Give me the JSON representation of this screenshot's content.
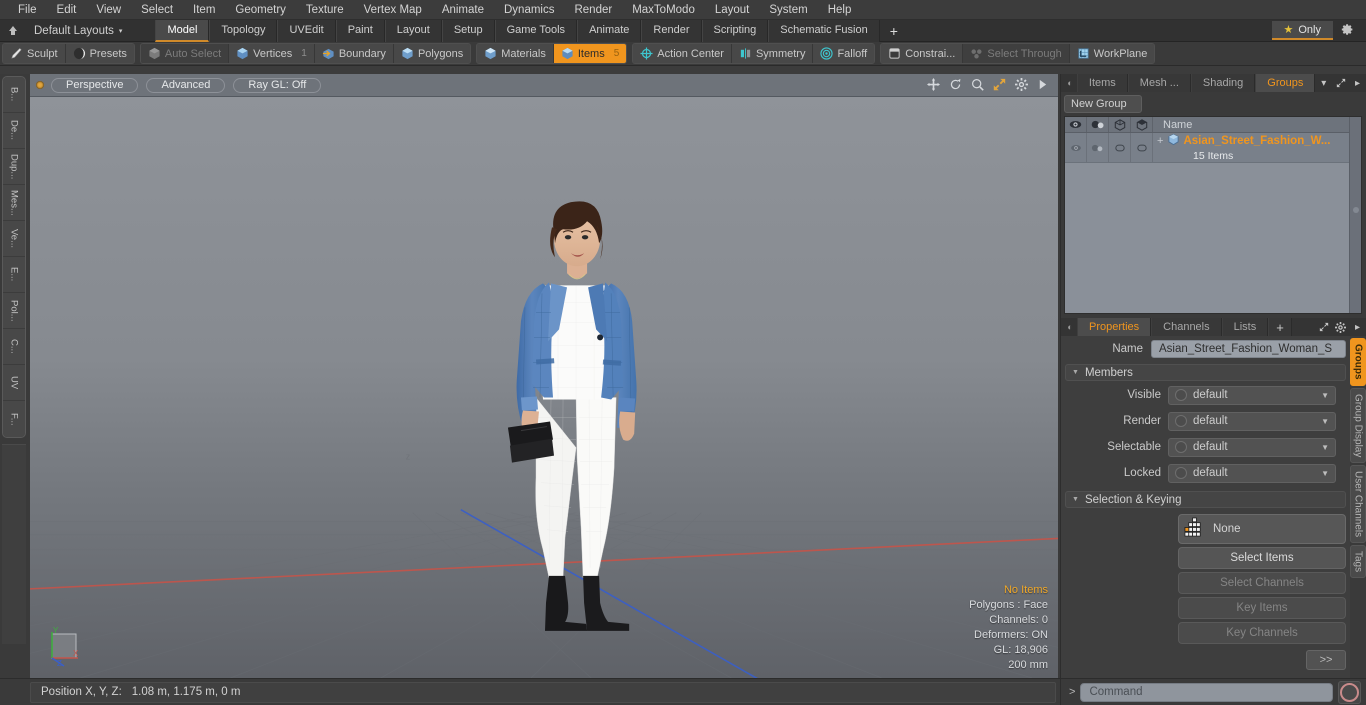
{
  "menu": {
    "items": [
      "File",
      "Edit",
      "View",
      "Select",
      "Item",
      "Geometry",
      "Texture",
      "Vertex Map",
      "Animate",
      "Dynamics",
      "Render",
      "MaxToModo",
      "Layout",
      "System",
      "Help"
    ]
  },
  "layoutbar": {
    "home_icon": "home-icon",
    "layouts_label": "Default Layouts",
    "caret": "▾",
    "tabs": [
      "Model",
      "Topology",
      "UVEdit",
      "Paint",
      "Layout",
      "Setup",
      "Game Tools",
      "Animate",
      "Render",
      "Scripting",
      "Schematic Fusion"
    ],
    "active_tab": "Model",
    "plus": "+",
    "only_label": "Only",
    "star_icon": "star-icon",
    "gear_icon": "gear-icon"
  },
  "modebar": {
    "groups": [
      {
        "buttons": [
          {
            "label": "Sculpt",
            "icon": "brush-icon",
            "state": "normal",
            "count": ""
          },
          {
            "label": "Presets",
            "icon": "sphere-icon",
            "state": "normal",
            "count": ""
          }
        ]
      },
      {
        "buttons": [
          {
            "label": "Auto Select",
            "icon": "cube-gray-icon",
            "state": "dim",
            "count": ""
          },
          {
            "label": "Vertices",
            "icon": "cube-vertex-icon",
            "state": "normal",
            "count": "1"
          },
          {
            "label": "Boundary",
            "icon": "cube-boundary-icon",
            "state": "normal",
            "count": ""
          },
          {
            "label": "Polygons",
            "icon": "cube-polygon-icon",
            "state": "normal",
            "count": ""
          }
        ]
      },
      {
        "buttons": [
          {
            "label": "Materials",
            "icon": "cube-material-icon",
            "state": "normal",
            "count": ""
          },
          {
            "label": "Items",
            "icon": "cube-items-icon",
            "state": "on",
            "count": "5"
          }
        ]
      },
      {
        "buttons": [
          {
            "label": "Action Center",
            "icon": "crosshair-icon",
            "state": "normal",
            "count": ""
          },
          {
            "label": "Symmetry",
            "icon": "symmetry-icon",
            "state": "normal",
            "count": ""
          },
          {
            "label": "Falloff",
            "icon": "falloff-icon",
            "state": "normal",
            "count": ""
          }
        ]
      },
      {
        "buttons": [
          {
            "label": "Constrai...",
            "icon": "constraint-icon",
            "state": "normal",
            "count": ""
          },
          {
            "label": "Select Through",
            "icon": "select-through-icon",
            "state": "dim",
            "count": ""
          },
          {
            "label": "WorkPlane",
            "icon": "workplane-icon",
            "state": "normal",
            "count": ""
          }
        ]
      }
    ]
  },
  "left_toolbox": {
    "items": [
      "B...",
      "De...",
      "Dup...",
      "Mes...",
      "Ve...",
      "E...",
      "Pol...",
      "C...",
      "UV",
      "F..."
    ]
  },
  "viewport": {
    "indicator": "viewport-active-dot",
    "pills": [
      "Perspective",
      "Advanced",
      "Ray GL: Off"
    ],
    "icons": [
      "move-icon",
      "rotate-icon",
      "zoom-icon",
      "fit-icon",
      "settings-icon",
      "play-icon"
    ],
    "stats": {
      "selection": "No Items",
      "polygons": "Polygons : Face",
      "channels": "Channels: 0",
      "deformers": "Deformers: ON",
      "gl": "GL: 18,906",
      "grid": "200 mm"
    },
    "axis": {
      "x": "X",
      "y": "Y",
      "z": "Z"
    }
  },
  "groups_panel": {
    "tabs": [
      "Items",
      "Mesh ...",
      "Shading",
      "Groups"
    ],
    "active_tab": "Groups",
    "plus": "",
    "new_group_label": "New Group",
    "columns": [
      "eye-icon",
      "render-icon",
      "wireframe-icon",
      "shaded-icon",
      "Name"
    ],
    "rows": [
      {
        "expander": "+",
        "icon": "group-icon",
        "name": "Asian_Street_Fashion_W...",
        "sub": "15 Items"
      }
    ]
  },
  "properties_panel": {
    "tabs": [
      "Properties",
      "Channels",
      "Lists"
    ],
    "active_tab": "Properties",
    "plus": "+",
    "name_label": "Name",
    "name_value": "Asian_Street_Fashion_Woman_S",
    "sections": [
      {
        "title": "Members",
        "rows": [
          {
            "label": "Visible",
            "value": "default"
          },
          {
            "label": "Render",
            "value": "default"
          },
          {
            "label": "Selectable",
            "value": "default"
          },
          {
            "label": "Locked",
            "value": "default"
          }
        ]
      },
      {
        "title": "Selection & Keying",
        "none_label": "None",
        "none_icon": "selection-grid-icon",
        "buttons": [
          {
            "label": "Select Items",
            "enabled": true
          },
          {
            "label": "Select Channels",
            "enabled": false
          },
          {
            "label": "Key Items",
            "enabled": false
          },
          {
            "label": "Key Channels",
            "enabled": false
          }
        ],
        "more_label": ">>"
      }
    ],
    "vertical_tabs": [
      "Groups",
      "Group Display",
      "User Channels",
      "Tags"
    ],
    "active_vertical_tab": "Groups"
  },
  "statusbar": {
    "position_label": "Position X, Y, Z:",
    "position_value": "1.08 m, 1.175 m, 0 m",
    "command_placeholder": "Command",
    "command_prompt": ">",
    "record_icon": "record-icon"
  },
  "colors": {
    "accent": "#f0951e",
    "panel_bg": "#3a3a3a",
    "viewport_top": "#8d9197",
    "axis_x": "#c4544a",
    "axis_z": "#3a5fc8",
    "jacket": "#4a76b0"
  }
}
